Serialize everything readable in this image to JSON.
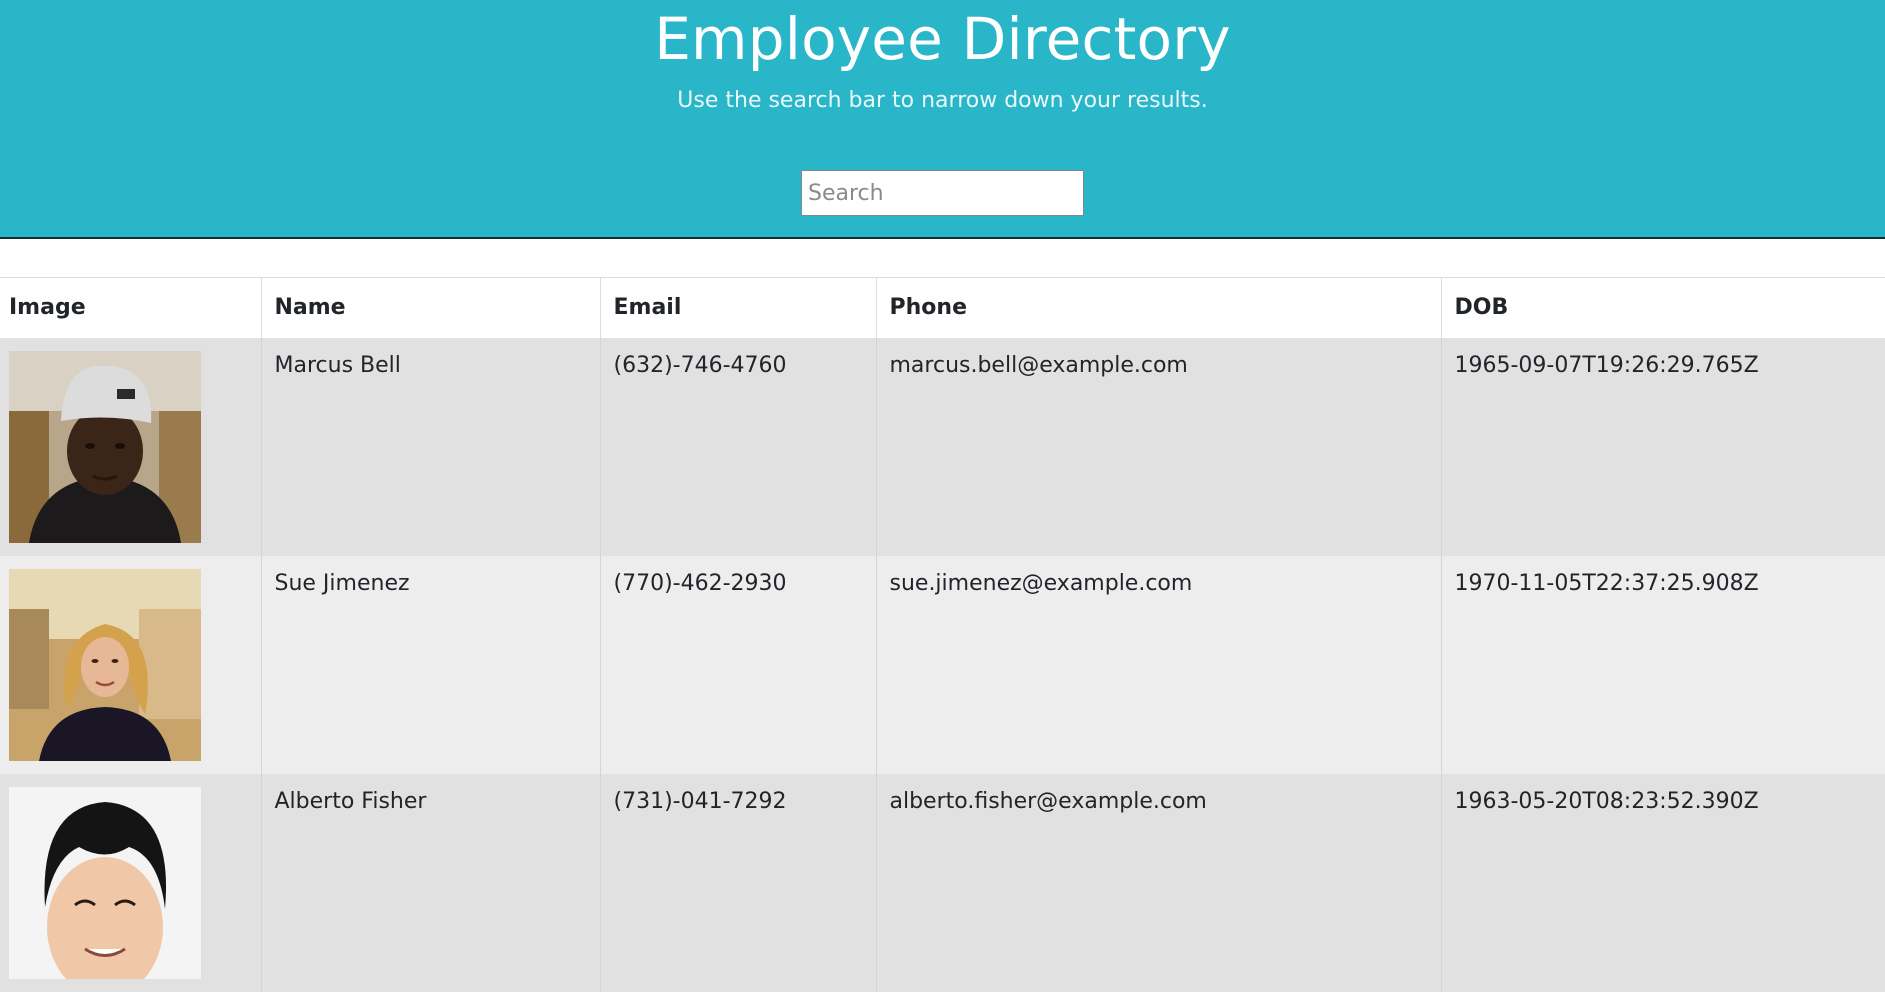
{
  "header": {
    "title": "Employee Directory",
    "subtitle": "Use the search bar to narrow down your results.",
    "search_placeholder": "Search"
  },
  "table": {
    "columns": [
      "Image",
      "Name",
      "Email",
      "Phone",
      "DOB"
    ],
    "rows": [
      {
        "name": "Marcus Bell",
        "email": "(632)-746-4760",
        "phone": "marcus.bell@example.com",
        "dob": "1965-09-07T19:26:29.765Z"
      },
      {
        "name": "Sue Jimenez",
        "email": "(770)-462-2930",
        "phone": "sue.jimenez@example.com",
        "dob": "1970-11-05T22:37:25.908Z"
      },
      {
        "name": "Alberto Fisher",
        "email": "(731)-041-7292",
        "phone": "alberto.fisher@example.com",
        "dob": "1963-05-20T08:23:52.390Z"
      }
    ]
  },
  "colors": {
    "header_bg": "#29b6c9",
    "row_a": "#e1e1e1",
    "row_b": "#ededed"
  }
}
